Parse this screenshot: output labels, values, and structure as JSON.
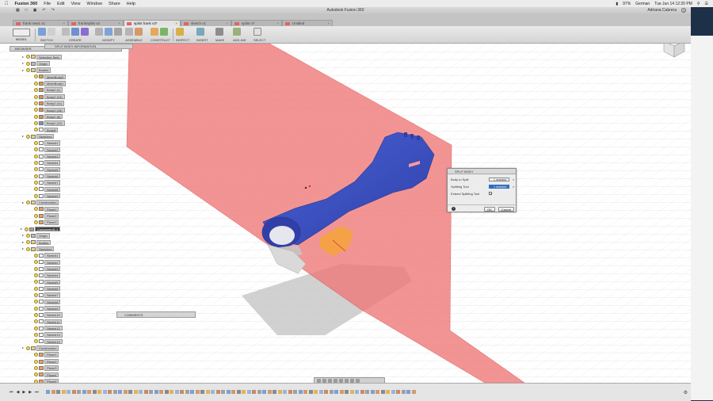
{
  "menubar": {
    "app_name": "Fusion 360",
    "menus": [
      "File",
      "Edit",
      "View",
      "Window",
      "Share",
      "Help"
    ],
    "battery": "97%",
    "input_language": "German",
    "clock": "Tue Jun 14  12:20 PM"
  },
  "window": {
    "title": "Autodesk Fusion 360",
    "user": "Adriana Cabrera"
  },
  "tabs": [
    {
      "label": "frank new1 v1"
    },
    {
      "label": "frankSplits v2"
    },
    {
      "label": "splint frank v3*"
    },
    {
      "label": "sketch v1"
    },
    {
      "label": "splint v7"
    },
    {
      "label": "Untitled"
    }
  ],
  "toolbar": {
    "workspace": "MODEL",
    "groups": [
      "SKETCH",
      "CREATE",
      "MODIFY",
      "ASSEMBLE",
      "CONSTRUCT",
      "INSPECT",
      "INSERT",
      "MAKE",
      "ADD-INS",
      "SELECT"
    ]
  },
  "browser": {
    "header": "BROWSER",
    "split_info": "SPLIT BODY INFORMATION",
    "tree": [
      {
        "label": "Selection Sets",
        "indent": 0,
        "icon": "folder"
      },
      {
        "label": "Origin",
        "indent": 0,
        "icon": "origin"
      },
      {
        "label": "Bodies",
        "indent": 0,
        "icon": "folder"
      },
      {
        "label": "MeshBody3",
        "indent": 1,
        "icon": "mesh"
      },
      {
        "label": "MeshBody1",
        "indent": 1,
        "icon": "mesh"
      },
      {
        "label": "Body2 (1)",
        "indent": 1,
        "icon": "body"
      },
      {
        "label": "Body2 (10)",
        "indent": 1,
        "icon": "body"
      },
      {
        "label": "Body2 (11)",
        "indent": 1,
        "icon": "body"
      },
      {
        "label": "Body2 (18)",
        "indent": 1,
        "icon": "body"
      },
      {
        "label": "Body2 (6)",
        "indent": 1,
        "icon": "body"
      },
      {
        "label": "Body2 (12)",
        "indent": 1,
        "icon": "bodyblue"
      },
      {
        "label": "Body8",
        "indent": 1,
        "icon": "sketch"
      },
      {
        "label": "Sketches",
        "indent": 0,
        "icon": "folder"
      },
      {
        "label": "Sketch1",
        "indent": 1,
        "icon": "sketch"
      },
      {
        "label": "Sketch2",
        "indent": 1,
        "icon": "sketch"
      },
      {
        "label": "Sketch3",
        "indent": 1,
        "icon": "sketch"
      },
      {
        "label": "Sketch4",
        "indent": 1,
        "icon": "sketch"
      },
      {
        "label": "Sketch5",
        "indent": 1,
        "icon": "sketch"
      },
      {
        "label": "Sketch6",
        "indent": 1,
        "icon": "sketch"
      },
      {
        "label": "Sketch7",
        "indent": 1,
        "icon": "sketch"
      },
      {
        "label": "Sketch8",
        "indent": 1,
        "icon": "sketch"
      },
      {
        "label": "Sketch9",
        "indent": 1,
        "icon": "sketch"
      },
      {
        "label": "Construction",
        "indent": 0,
        "icon": "folder"
      },
      {
        "label": "Plane1",
        "indent": 1,
        "icon": "plane"
      },
      {
        "label": "Plane2",
        "indent": 1,
        "icon": "plane"
      },
      {
        "label": "Plane3",
        "indent": 1,
        "icon": "plane"
      },
      {
        "label": "Component1:1",
        "indent": -1,
        "icon": "comp"
      },
      {
        "label": "Origin",
        "indent": 0,
        "icon": "origin"
      },
      {
        "label": "Bodies",
        "indent": 0,
        "icon": "folder"
      },
      {
        "label": "Sketches",
        "indent": 0,
        "icon": "folder"
      },
      {
        "label": "Sketch1",
        "indent": 1,
        "icon": "sketch"
      },
      {
        "label": "Sketch2",
        "indent": 1,
        "icon": "sketch"
      },
      {
        "label": "Sketch3",
        "indent": 1,
        "icon": "sketch"
      },
      {
        "label": "Sketch4",
        "indent": 1,
        "icon": "sketch"
      },
      {
        "label": "Sketch5",
        "indent": 1,
        "icon": "sketch"
      },
      {
        "label": "Sketch6",
        "indent": 1,
        "icon": "sketch"
      },
      {
        "label": "Sketch7",
        "indent": 1,
        "icon": "sketch"
      },
      {
        "label": "Sketch8",
        "indent": 1,
        "icon": "sketch"
      },
      {
        "label": "Sketch9",
        "indent": 1,
        "icon": "sketch"
      },
      {
        "label": "Sketch10",
        "indent": 1,
        "icon": "sketch"
      },
      {
        "label": "Sketch11",
        "indent": 1,
        "icon": "sketch"
      },
      {
        "label": "Sketch12",
        "indent": 1,
        "icon": "sketch"
      },
      {
        "label": "Sketch13",
        "indent": 1,
        "icon": "sketch"
      },
      {
        "label": "Sketch14",
        "indent": 1,
        "icon": "sketch"
      },
      {
        "label": "Construction",
        "indent": 0,
        "icon": "folder"
      },
      {
        "label": "Plane1",
        "indent": 1,
        "icon": "plane"
      },
      {
        "label": "Plane2",
        "indent": 1,
        "icon": "plane"
      },
      {
        "label": "Plane3",
        "indent": 1,
        "icon": "plane"
      },
      {
        "label": "Plane4",
        "indent": 1,
        "icon": "plane"
      },
      {
        "label": "Plane5",
        "indent": 1,
        "icon": "plane"
      }
    ]
  },
  "comments": {
    "label": "COMMENTS"
  },
  "split_body": {
    "title": "SPLIT BODY",
    "body_to_split_label": "Body to Split",
    "body_to_split_value": "1 selected",
    "splitting_tool_label": "Splitting Tool",
    "splitting_tool_value": "1 selected",
    "extend_label": "Extend Splitting Tool",
    "extend_checked": true,
    "ok": "OK",
    "cancel": "Cancel"
  },
  "status": {
    "selections": "2 selections"
  },
  "colors": {
    "plane": "#f07777",
    "body": "#4455c4",
    "accent": "#2e6dbf"
  }
}
